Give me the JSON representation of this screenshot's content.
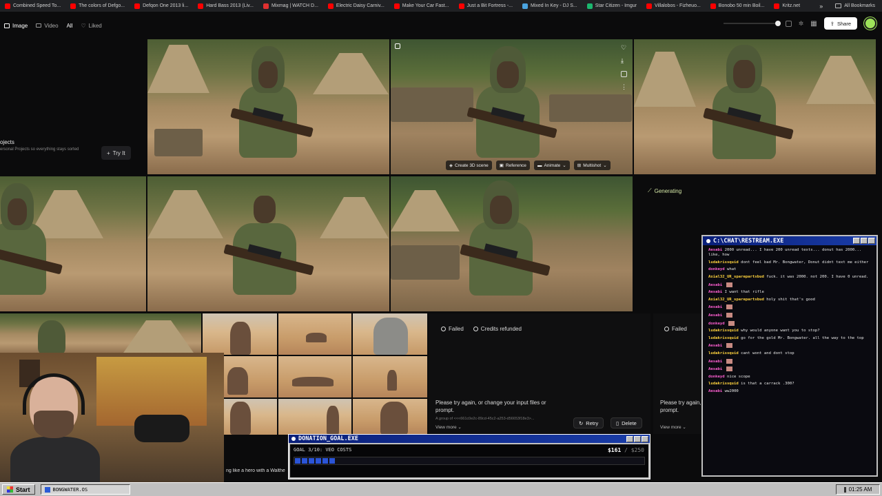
{
  "bookmarks": [
    {
      "label": "Combined Speed To...",
      "color": "#ff0000"
    },
    {
      "label": "The colors of Defgo...",
      "color": "#ff0000"
    },
    {
      "label": "Defqon One 2013 li...",
      "color": "#ff0000"
    },
    {
      "label": "Hard Bass 2013 (Liv...",
      "color": "#ff0000"
    },
    {
      "label": "Mixmag | WATCH D...",
      "color": "#e03030"
    },
    {
      "label": "Electric Daisy Carniv...",
      "color": "#ff0000"
    },
    {
      "label": "Make Your Car Fast...",
      "color": "#ff0000"
    },
    {
      "label": "Just a Bit Fortress -...",
      "color": "#ff0000"
    },
    {
      "label": "Mixed In Key - DJ S...",
      "color": "#4aa3df"
    },
    {
      "label": "Star Citizen - Imgur",
      "color": "#1bb76e"
    },
    {
      "label": "Villalobos - Fizheuo...",
      "color": "#ff0000"
    },
    {
      "label": "Bonobo 50 min Boil...",
      "color": "#ff0000"
    },
    {
      "label": "Kritz.net",
      "color": "#ff0000"
    }
  ],
  "bookmarks_more": "»",
  "all_bookmarks": "All Bookmarks",
  "toolbar": {
    "tabs": [
      {
        "label": "Image",
        "icon": "image-icon",
        "active": true
      },
      {
        "label": "Video",
        "icon": "video-icon",
        "active": false
      },
      {
        "label": "All",
        "icon": "",
        "active": true
      },
      {
        "label": "Liked",
        "icon": "heart-icon",
        "active": false
      }
    ],
    "share_label": "Share"
  },
  "left_card": {
    "title": "ojects",
    "subtitle": "ersonal Projects so everything stays sorted",
    "try_label": "Try It"
  },
  "image_overlay": {
    "create_3d": "Create 3D scene",
    "reference": "Reference",
    "animate": "Animate",
    "multishot": "Multishot"
  },
  "generating_label": "Generating",
  "failed_panels": [
    {
      "status": "Failed",
      "credits": "Credits refunded",
      "message": "Please try again, or change your input files or prompt.",
      "hash": "A group of <<<661c0e2c-89cd-45c2-a253-d56653f18e3>...",
      "view_more": "View more",
      "retry": "Retry",
      "delete": "Delete"
    },
    {
      "status": "Failed",
      "message": "Please try again,",
      "message2": "prompt.",
      "view_more": "View more"
    }
  ],
  "chat": {
    "title": "C:\\CHAT\\RESTREAM.EXE",
    "messages": [
      {
        "user": "Aesabi",
        "color": "#ff5fd2",
        "text": "2000 unread... I have 200 unread texts... donut has 2000... like, how"
      },
      {
        "user": "ludakrissquid",
        "color": "#ffd33d",
        "text": "dont feel bad Mr. Bongwater, Donut didnt text me either"
      },
      {
        "user": "donkeyd",
        "color": "#ff5fd2",
        "text": "what"
      },
      {
        "user": "Axial32_UR_sparepartsbud",
        "color": "#ffd33d",
        "text": "fuck. it was 2000. not 200. I have 0 unread."
      },
      {
        "user": "Aesabi",
        "color": "#ff5fd2",
        "text": ""
      },
      {
        "user": "Aesabi",
        "color": "#ff5fd2",
        "text": "I want that rifle"
      },
      {
        "user": "Axial32_UR_sparepartsbud",
        "color": "#ffd33d",
        "text": "holy shit that's good"
      },
      {
        "user": "Aesabi",
        "color": "#ff5fd2",
        "text": ""
      },
      {
        "user": "Aesabi",
        "color": "#ff5fd2",
        "text": ""
      },
      {
        "user": "donkeyd",
        "color": "#ff5fd2",
        "text": ""
      },
      {
        "user": "ludakrissquid",
        "color": "#ffd33d",
        "text": "why would anyone want you to stop?"
      },
      {
        "user": "ludakrissquid",
        "color": "#ffd33d",
        "text": "go for the gold Mr. Bongwater. all the way to the top"
      },
      {
        "user": "Aesabi",
        "color": "#ff5fd2",
        "text": ""
      },
      {
        "user": "ludakrissquid",
        "color": "#ffd33d",
        "text": "cant wont and dont stop"
      },
      {
        "user": "Aesabi",
        "color": "#ff5fd2",
        "text": ""
      },
      {
        "user": "Aesabi",
        "color": "#ff5fd2",
        "text": ""
      },
      {
        "user": "donkeyd",
        "color": "#ff5fd2",
        "text": "nice scope"
      },
      {
        "user": "ludakrissquid",
        "color": "#ffd33d",
        "text": "is that a carrack .300?"
      },
      {
        "user": "Aesabi",
        "color": "#ff5fd2",
        "text": "ww2000"
      }
    ]
  },
  "donation": {
    "title": "DONATION_GOAL.EXE",
    "label": "GOAL 3/10: VEO COSTS",
    "current": "$161",
    "separator": "/",
    "goal": "$250",
    "progress": 0.64
  },
  "webcam_caption": "ng like a hero with a Walthe",
  "taskbar": {
    "start_label": "Start",
    "task_label": "BONGWATER.OS",
    "clock": "01:25 AM"
  }
}
